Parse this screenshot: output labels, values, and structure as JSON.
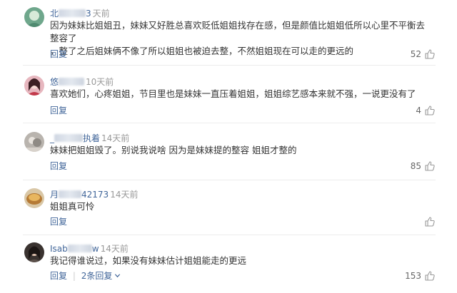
{
  "comments": [
    {
      "username_visible": "北",
      "username_suffix": "3",
      "time": "天前",
      "text_lines": [
        "因为妹妹比姐姐丑，妹妹又好胜总喜欢贬低姐姐找存在感，但是颜值比姐姐低所以心里不平衡去整容了",
        "，整了之后姐妹俩不像了所以姐姐也被迫去整，不然姐姐现在可以走的更远的"
      ],
      "reply_label": "回复",
      "likes": "52"
    },
    {
      "username_visible": "悠",
      "username_suffix": "",
      "time": "10天前",
      "text_lines": [
        "喜欢她们，心疼姐姐，节目里也是妹妹一直压着姐姐，姐姐综艺感本来就不强，一说更没有了"
      ],
      "reply_label": "回复",
      "likes": "4"
    },
    {
      "username_visible": "_",
      "username_suffix": "执着",
      "time": "14天前",
      "text_lines": [
        "妹妹把姐姐毁了。别说我说啥 因为是妹妹提的整容 姐姐才整的"
      ],
      "reply_label": "回复",
      "likes": "85"
    },
    {
      "username_visible": "月",
      "username_suffix": "42173",
      "time": "14天前",
      "text_lines": [
        "姐姐真可怜"
      ],
      "reply_label": "回复",
      "likes": ""
    },
    {
      "username_visible": "Isab",
      "username_suffix": "w",
      "time": "14天前",
      "text_lines": [
        "我记得谁说过，如果没有妹妹估计姐姐能走的更远"
      ],
      "reply_label": "回复",
      "replies_label": "2条回复",
      "likes": "153"
    }
  ],
  "icons": {
    "like": "thumbs-up-icon",
    "expand": "chevron-down-icon"
  },
  "colors": {
    "link": "#406599",
    "text": "#333333",
    "muted": "#999999",
    "separator": "#ececec"
  }
}
